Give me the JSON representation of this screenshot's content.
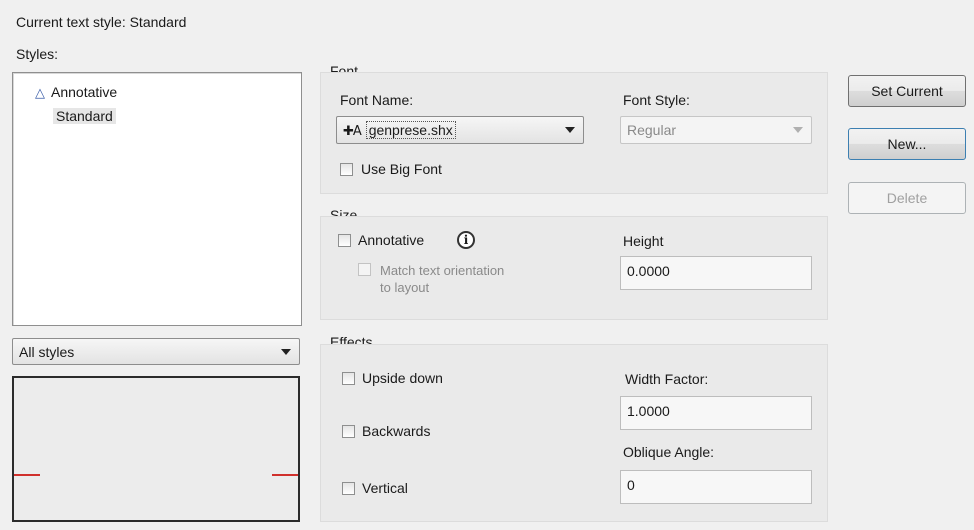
{
  "header": {
    "current_style_label": "Current text style:",
    "current_style_value": "Standard",
    "styles_label": "Styles:"
  },
  "styles_list": {
    "items": [
      {
        "label": "Annotative",
        "icon": "annotative-triangle-icon"
      },
      {
        "label": "Standard",
        "selected": true
      }
    ]
  },
  "filter": {
    "value": "All styles"
  },
  "font": {
    "group_label": "Font",
    "name_label": "Font Name:",
    "name_value": "genprese.shx",
    "style_label": "Font Style:",
    "style_value": "Regular",
    "big_font_label": "Use Big Font"
  },
  "size": {
    "group_label": "Size",
    "annotative_label": "Annotative",
    "match_label_line1": "Match text orientation",
    "match_label_line2": "to layout",
    "height_label": "Height",
    "height_value": "0.0000"
  },
  "effects": {
    "group_label": "Effects",
    "upside_down_label": "Upside down",
    "backwards_label": "Backwards",
    "vertical_label": "Vertical",
    "width_factor_label": "Width Factor:",
    "width_factor_value": "1.0000",
    "oblique_label": "Oblique Angle:",
    "oblique_value": "0"
  },
  "buttons": {
    "set_current": "Set Current",
    "new": "New...",
    "delete": "Delete"
  },
  "colors": {
    "preview_line": "#d0302c",
    "annotative_icon": "#3a5da8"
  }
}
